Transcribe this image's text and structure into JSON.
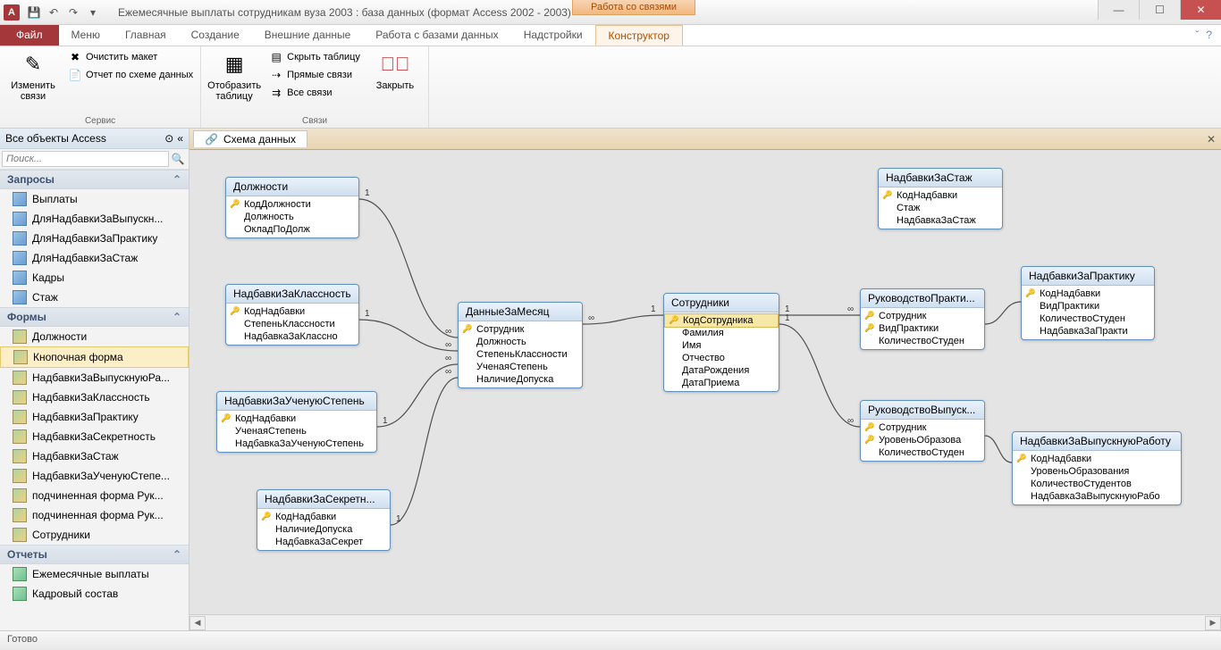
{
  "titlebar": {
    "app_letter": "A",
    "title": "Ежемесячные выплаты сотрудникам вуза 2003 : база данных (формат Access 2002 - 2003)",
    "contextual": "Работа со связями"
  },
  "tabs": {
    "file": "Файл",
    "t1": "Меню",
    "t2": "Главная",
    "t3": "Создание",
    "t4": "Внешние данные",
    "t5": "Работа с базами данных",
    "t6": "Надстройки",
    "active": "Конструктор"
  },
  "ribbon": {
    "g1_label": "Сервис",
    "btn_edit": "Изменить связи",
    "btn_clear": "Очистить макет",
    "btn_report": "Отчет по схеме данных",
    "g2_label": "Связи",
    "btn_show": "Отобразить таблицу",
    "btn_hide": "Скрыть таблицу",
    "btn_direct": "Прямые связи",
    "btn_all": "Все связи",
    "btn_close": "Закрыть"
  },
  "nav": {
    "header": "Все объекты Access",
    "search_ph": "Поиск...",
    "cats": {
      "queries": "Запросы",
      "forms": "Формы",
      "reports": "Отчеты"
    },
    "queries": [
      "Выплаты",
      "ДляНадбавкиЗаВыпускн...",
      "ДляНадбавкиЗаПрактику",
      "ДляНадбавкиЗаСтаж",
      "Кадры",
      "Стаж"
    ],
    "forms": [
      "Должности",
      "Кнопочная форма",
      "НадбавкиЗаВыпускнуюРа...",
      "НадбавкиЗаКлассность",
      "НадбавкиЗаПрактику",
      "НадбавкиЗаСекретность",
      "НадбавкиЗаСтаж",
      "НадбавкиЗаУченуюСтепе...",
      "подчиненная форма Рук...",
      "подчиненная форма Рук...",
      "Сотрудники"
    ],
    "reports": [
      "Ежемесячные выплаты",
      "Кадровый состав"
    ],
    "selected_form": "Кнопочная форма"
  },
  "doc": {
    "tab": "Схема данных"
  },
  "tables": {
    "dolzhnosti": {
      "title": "Должности",
      "fields": [
        {
          "n": "КодДолжности",
          "k": true
        },
        {
          "n": "Должность"
        },
        {
          "n": "ОкладПоДолж"
        }
      ]
    },
    "nadklass": {
      "title": "НадбавкиЗаКлассность",
      "fields": [
        {
          "n": "КодНадбавки",
          "k": true
        },
        {
          "n": "СтепеньКлассности"
        },
        {
          "n": "НадбавкаЗаКлассно"
        }
      ]
    },
    "naduch": {
      "title": "НадбавкиЗаУченуюСтепень",
      "fields": [
        {
          "n": "КодНадбавки",
          "k": true
        },
        {
          "n": "УченаяСтепень"
        },
        {
          "n": "НадбавкаЗаУченуюСтепень"
        }
      ]
    },
    "nadsekr": {
      "title": "НадбавкиЗаСекретн...",
      "fields": [
        {
          "n": "КодНадбавки",
          "k": true
        },
        {
          "n": "НаличиеДопуска"
        },
        {
          "n": "НадбавкаЗаСекрет"
        }
      ]
    },
    "dannye": {
      "title": "ДанныеЗаМесяц",
      "fields": [
        {
          "n": "Сотрудник",
          "k": true
        },
        {
          "n": "Должность"
        },
        {
          "n": "СтепеньКлассности"
        },
        {
          "n": "УченаяСтепень"
        },
        {
          "n": "НаличиеДопуска"
        }
      ]
    },
    "sotr": {
      "title": "Сотрудники",
      "fields": [
        {
          "n": "КодСотрудника",
          "k": true,
          "sel": true
        },
        {
          "n": "Фамилия"
        },
        {
          "n": "Имя"
        },
        {
          "n": "Отчество"
        },
        {
          "n": "ДатаРождения"
        },
        {
          "n": "ДатаПриема"
        }
      ]
    },
    "nadstazh": {
      "title": "НадбавкиЗаСтаж",
      "fields": [
        {
          "n": "КодНадбавки",
          "k": true
        },
        {
          "n": "Стаж"
        },
        {
          "n": "НадбавкаЗаСтаж"
        }
      ]
    },
    "rukpr": {
      "title": "РуководствоПракти...",
      "fields": [
        {
          "n": "Сотрудник",
          "k": true
        },
        {
          "n": "ВидПрактики",
          "k": true
        },
        {
          "n": "КоличествоСтуден"
        }
      ]
    },
    "rukvyp": {
      "title": "РуководствоВыпуск...",
      "fields": [
        {
          "n": "Сотрудник",
          "k": true
        },
        {
          "n": "УровеньОбразова",
          "k": true
        },
        {
          "n": "КоличествоСтуден"
        }
      ]
    },
    "nadprakt": {
      "title": "НадбавкиЗаПрактику",
      "fields": [
        {
          "n": "КодНадбавки",
          "k": true
        },
        {
          "n": "ВидПрактики"
        },
        {
          "n": "КоличествоСтуден"
        },
        {
          "n": "НадбавкаЗаПракти"
        }
      ]
    },
    "nadvyp": {
      "title": "НадбавкиЗаВыпускнуюРаботу",
      "fields": [
        {
          "n": "КодНадбавки",
          "k": true
        },
        {
          "n": "УровеньОбразования"
        },
        {
          "n": "КоличествоСтудентов"
        },
        {
          "n": "НадбавкаЗаВыпускнуюРабо"
        }
      ]
    }
  },
  "status": "Готово"
}
